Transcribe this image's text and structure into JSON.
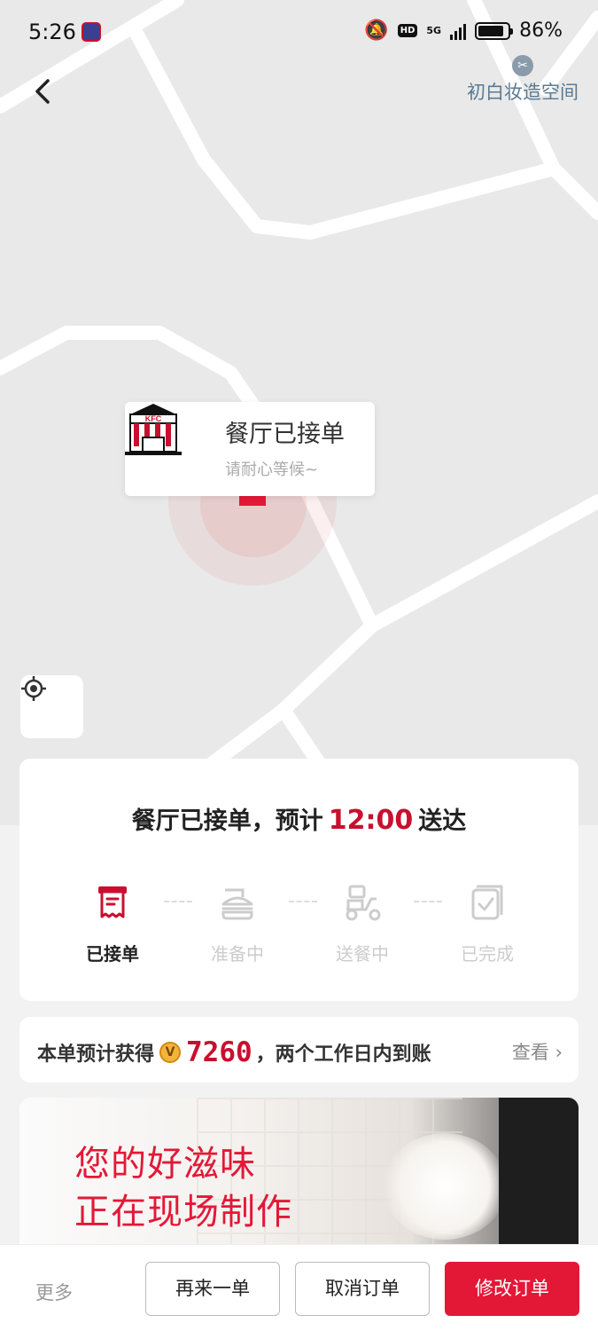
{
  "status_bar": {
    "time": "5:26",
    "battery": "86%",
    "network": "5G",
    "hd": "HD"
  },
  "map": {
    "poi_name": "初白妆造空间",
    "popup": {
      "title": "餐厅已接单",
      "subtitle": "请耐心等候~",
      "brand": "KFC"
    }
  },
  "order": {
    "headline_prefix": "餐厅已接单，预计",
    "eta": "12:00",
    "headline_suffix": "送达",
    "steps": [
      {
        "label": "已接单",
        "icon": "receipt-icon",
        "active": true
      },
      {
        "label": "准备中",
        "icon": "burger-icon",
        "active": false
      },
      {
        "label": "送餐中",
        "icon": "scooter-icon",
        "active": false
      },
      {
        "label": "已完成",
        "icon": "checkbox-icon",
        "active": false
      }
    ]
  },
  "points": {
    "prefix": "本单预计获得",
    "coin": "V",
    "value": "7260",
    "suffix": "，两个工作日内到账",
    "view": "查看"
  },
  "banner": {
    "line1": "您的好滋味",
    "line2": "正在现场制作"
  },
  "bottom_bar": {
    "more": "更多",
    "reorder": "再来一单",
    "cancel": "取消订单",
    "modify": "修改订单"
  },
  "colors": {
    "accent": "#e31837",
    "eta": "#c8102e"
  }
}
